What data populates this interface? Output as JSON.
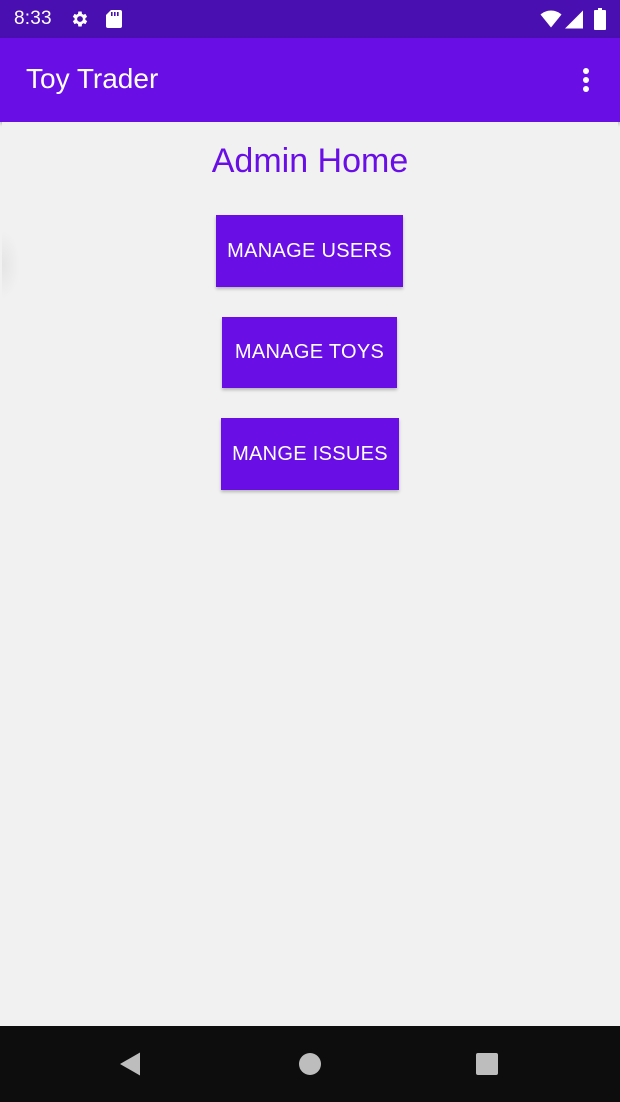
{
  "status_bar": {
    "time": "8:33",
    "icons": [
      "settings-icon",
      "sd-card-icon",
      "wifi-icon",
      "signal-icon",
      "battery-icon"
    ],
    "background": "#4a0fb0"
  },
  "app_bar": {
    "title": "Toy Trader",
    "menu_icon": "overflow-menu-icon",
    "background": "#6a0ee6"
  },
  "main": {
    "title": "Admin Home",
    "buttons": [
      {
        "label": "MANAGE USERS"
      },
      {
        "label": "MANAGE TOYS"
      },
      {
        "label": "MANGE ISSUES"
      }
    ],
    "accent": "#6a0ee6",
    "background": "#f1f1f1"
  },
  "nav_bar": {
    "icons": [
      "back-icon",
      "home-icon",
      "recents-icon"
    ]
  }
}
